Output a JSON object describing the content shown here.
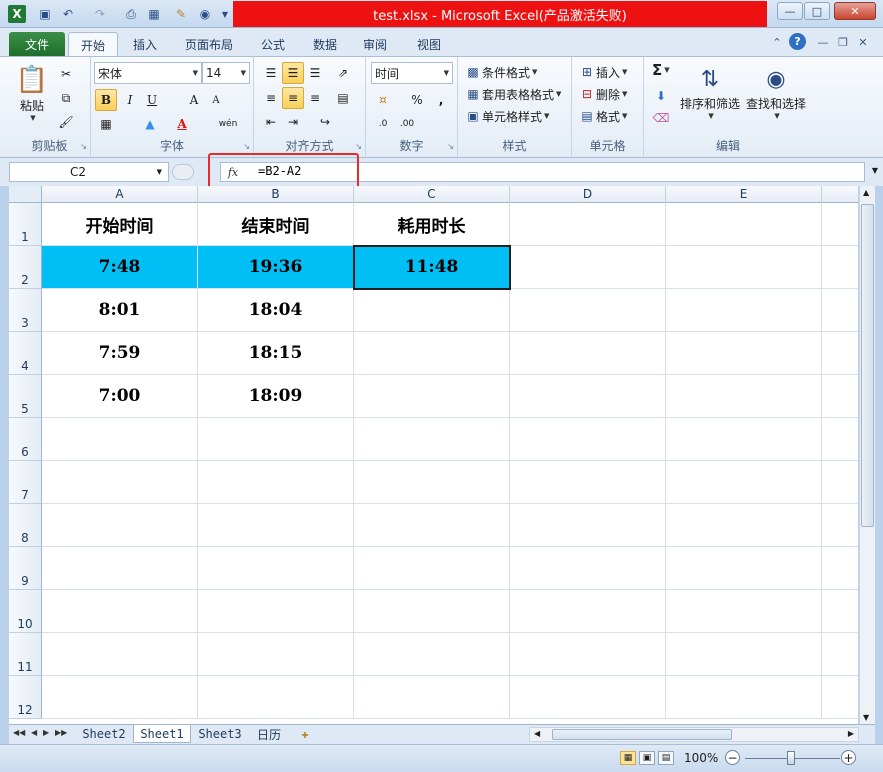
{
  "window": {
    "title": "test.xlsx - Microsoft Excel(产品激活失败)",
    "minimize_icon": "minimize-icon",
    "maximize_icon": "maximize-icon",
    "close_icon": "close-icon"
  },
  "colors": {
    "title_highlight": "#ee1111",
    "cell_highlight": "#00bff5",
    "formula_highlight_border": "#e62b2b",
    "file_tab": "#2a7f37"
  },
  "quick_access": [
    "excel-logo-icon",
    "save-icon",
    "undo-icon",
    "redo-icon",
    "print-preview-icon",
    "table-icon",
    "paste-icon",
    "camera-icon",
    "customize-icon"
  ],
  "tabs": [
    {
      "label": "文件",
      "active": false
    },
    {
      "label": "开始",
      "active": true
    },
    {
      "label": "插入",
      "active": false
    },
    {
      "label": "页面布局",
      "active": false
    },
    {
      "label": "公式",
      "active": false
    },
    {
      "label": "数据",
      "active": false
    },
    {
      "label": "审阅",
      "active": false
    },
    {
      "label": "视图",
      "active": false
    }
  ],
  "ribbon": {
    "clipboard": {
      "paste": "粘贴",
      "label": "剪贴板"
    },
    "font": {
      "name": "宋体",
      "size": "14",
      "bold": "B",
      "italic": "I",
      "underline": "U",
      "grow": "A",
      "shrink": "A",
      "label": "字体",
      "font_color": "A",
      "phonetic": "wén"
    },
    "alignment": {
      "label": "对齐方式"
    },
    "number": {
      "format": "时间",
      "percent": "%",
      "comma": ",",
      "label": "数字"
    },
    "styles": {
      "conditional": "条件格式",
      "table": "套用表格格式",
      "cell": "单元格样式",
      "label": "样式"
    },
    "cells": {
      "insert": "插入",
      "delete": "删除",
      "format": "格式",
      "label": "单元格"
    },
    "editing": {
      "sort": "排序和筛选",
      "find": "查找和选择",
      "label": "编辑",
      "sum": "Σ"
    }
  },
  "formula_bar": {
    "name_box": "C2",
    "fx": "fx",
    "formula": "=B2-A2"
  },
  "grid": {
    "columns": [
      "A",
      "B",
      "C",
      "D",
      "E"
    ],
    "rows": [
      "1",
      "2",
      "3",
      "4",
      "5",
      "6",
      "7",
      "8",
      "9",
      "10",
      "11",
      "12"
    ],
    "headers": [
      "开始时间",
      "结束时间",
      "耗用时长"
    ],
    "data": [
      [
        "7:48",
        "19:36",
        "11:48"
      ],
      [
        "8:01",
        "18:04",
        ""
      ],
      [
        "7:59",
        "18:15",
        ""
      ],
      [
        "7:00",
        "18:09",
        ""
      ]
    ],
    "selected_cell": "C2"
  },
  "sheets": [
    {
      "name": "Sheet2",
      "active": false
    },
    {
      "name": "Sheet1",
      "active": true
    },
    {
      "name": "Sheet3",
      "active": false
    },
    {
      "name": "日历",
      "active": false
    }
  ],
  "status": {
    "zoom": "100%",
    "zoom_out": "−",
    "zoom_in": "+"
  }
}
